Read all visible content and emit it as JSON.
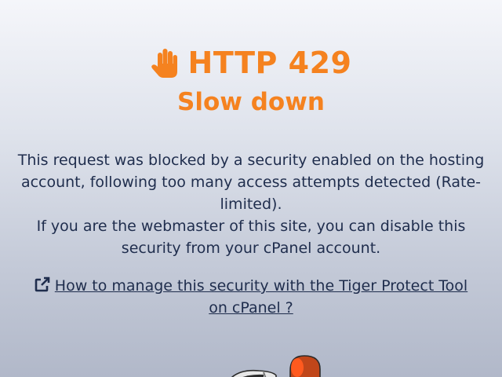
{
  "error": {
    "code_text": "HTTP 429",
    "subtitle": "Slow down"
  },
  "message": {
    "line1": "This request was blocked by a security enabled on the hosting account, following too many access attempts detected (Rate-limited).",
    "line2": "If you are the webmaster of this site, you can disable this security from your cPanel account."
  },
  "help_link": {
    "label": "How to manage this security with the Tiger Protect Tool on cPanel ?"
  },
  "colors": {
    "accent": "#f5821f",
    "text": "#1f2d4d"
  },
  "icons": {
    "heading": "hand-stop-icon",
    "link": "external-link-icon",
    "mascot": "tiger-mascot-icon"
  }
}
